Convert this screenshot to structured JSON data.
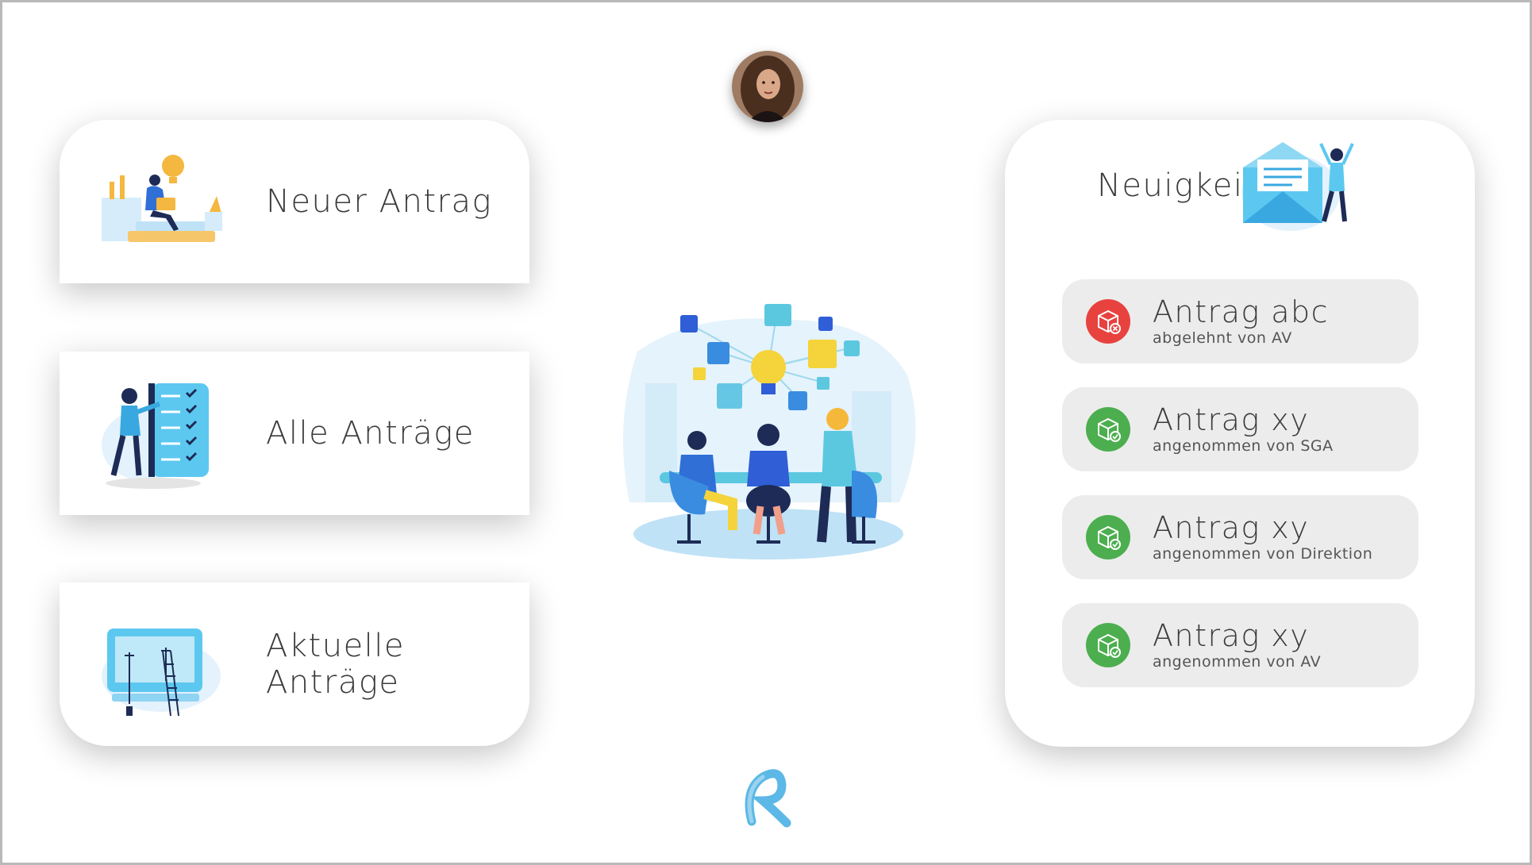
{
  "actions": [
    {
      "label": "Neuer Antrag",
      "icon": "person-with-laptop-icon"
    },
    {
      "label": "Alle Anträge",
      "icon": "checklist-icon"
    },
    {
      "label": "Aktuelle Anträge",
      "icon": "screen-construction-icon"
    }
  ],
  "news": {
    "title": "Neuigkeiten",
    "icon": "envelope-icon",
    "items": [
      {
        "title": "Antrag abc",
        "subtitle": "abgelehnt von AV",
        "status": "rejected",
        "color": "#e8423f"
      },
      {
        "title": "Antrag xy",
        "subtitle": "angenommen von SGA",
        "status": "accepted",
        "color": "#4cae4f"
      },
      {
        "title": "Antrag xy",
        "subtitle": "angenommen von Direktion",
        "status": "accepted",
        "color": "#4cae4f"
      },
      {
        "title": "Antrag xy",
        "subtitle": "angenommen von AV",
        "status": "accepted",
        "color": "#4cae4f"
      }
    ]
  },
  "colors": {
    "accent": "#3aa8e0",
    "rejected": "#e8423f",
    "accepted": "#4cae4f"
  }
}
